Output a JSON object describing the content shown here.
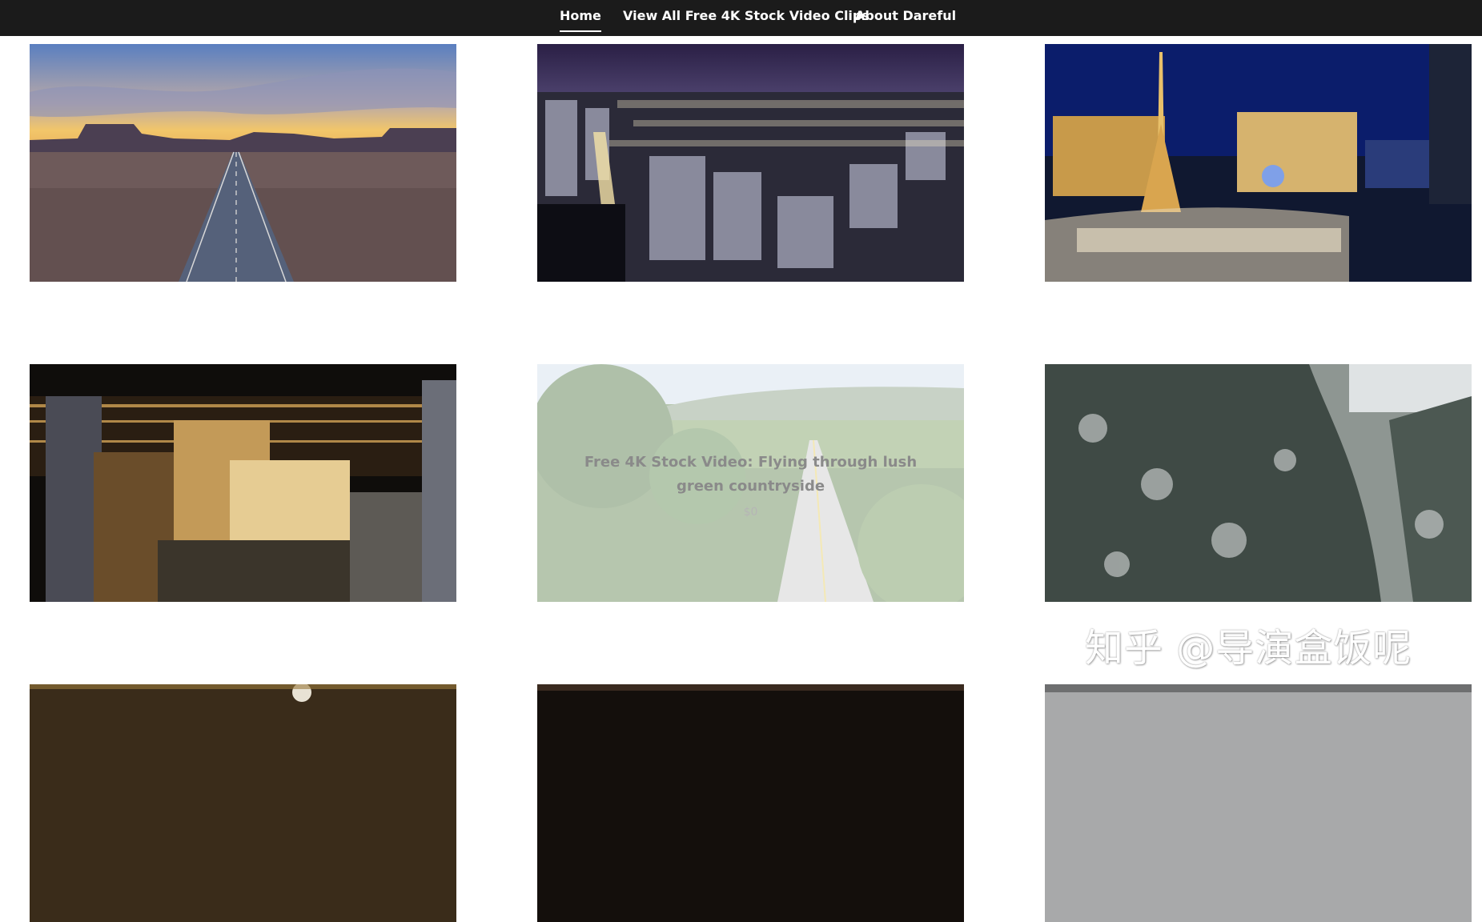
{
  "nav": {
    "home": "Home",
    "view_all": "View All Free 4K Stock Video Clips",
    "about": "About Dareful"
  },
  "tiles": [
    {
      "scene": "desert-highway-sunset"
    },
    {
      "scene": "tokyo-city-night"
    },
    {
      "scene": "las-vegas-paris-bellagio-night"
    },
    {
      "scene": "las-vegas-strip-night"
    },
    {
      "scene": "green-countryside-road",
      "title": "Free 4K Stock Video: Flying through lush green countryside",
      "price": "$0"
    },
    {
      "scene": "snowy-forest-valley"
    },
    {
      "scene": "christmas-lights-partial"
    },
    {
      "scene": "dark-interior-partial"
    },
    {
      "scene": "snowy-mountain-partial"
    }
  ],
  "watermark": "知乎 @导演盒饭呢",
  "colors": {
    "nav_bg": "#1b1b1b",
    "nav_text": "#ffffff",
    "overlay_title": "#8a8a8a"
  }
}
